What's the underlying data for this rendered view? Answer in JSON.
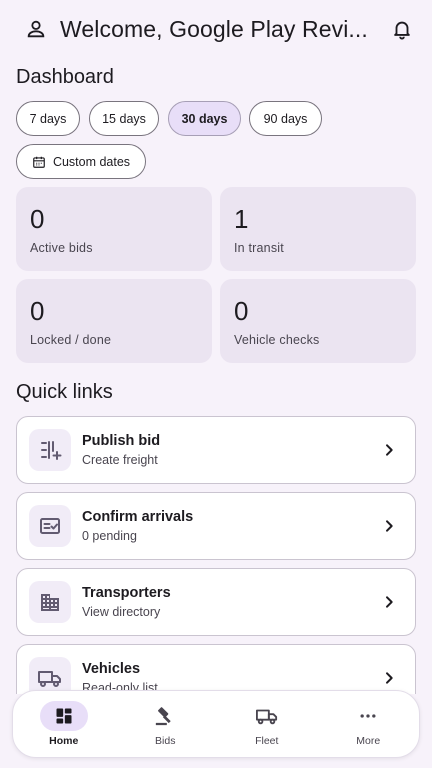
{
  "header": {
    "title": "Welcome, Google Play Revi..."
  },
  "dashboard": {
    "title": "Dashboard",
    "range_chips": [
      {
        "label": "7 days",
        "selected": false
      },
      {
        "label": "15 days",
        "selected": false
      },
      {
        "label": "30 days",
        "selected": true
      },
      {
        "label": "90 days",
        "selected": false
      }
    ],
    "custom_dates_label": "Custom dates",
    "stats": [
      {
        "value": "0",
        "label": "Active bids"
      },
      {
        "value": "1",
        "label": "In transit"
      },
      {
        "value": "0",
        "label": "Locked / done"
      },
      {
        "value": "0",
        "label": "Vehicle checks"
      }
    ]
  },
  "quick_links": {
    "title": "Quick links",
    "items": [
      {
        "title": "Publish bid",
        "subtitle": "Create freight",
        "icon": "publish-bid-icon"
      },
      {
        "title": "Confirm arrivals",
        "subtitle": "0 pending",
        "icon": "checklist-icon"
      },
      {
        "title": "Transporters",
        "subtitle": "View directory",
        "icon": "building-icon"
      },
      {
        "title": "Vehicles",
        "subtitle": "Read-only list",
        "icon": "truck-icon"
      }
    ]
  },
  "bottom_nav": {
    "items": [
      {
        "label": "Home",
        "icon": "dashboard-icon",
        "active": true
      },
      {
        "label": "Bids",
        "icon": "gavel-icon",
        "active": false
      },
      {
        "label": "Fleet",
        "icon": "truck-icon",
        "active": false
      },
      {
        "label": "More",
        "icon": "more-horiz-icon",
        "active": false
      }
    ]
  },
  "colors": {
    "background": "#f7f2fa",
    "accent_container": "#e8def8",
    "stat_card": "#ebe4f1",
    "icon_purple": "#625b71"
  }
}
